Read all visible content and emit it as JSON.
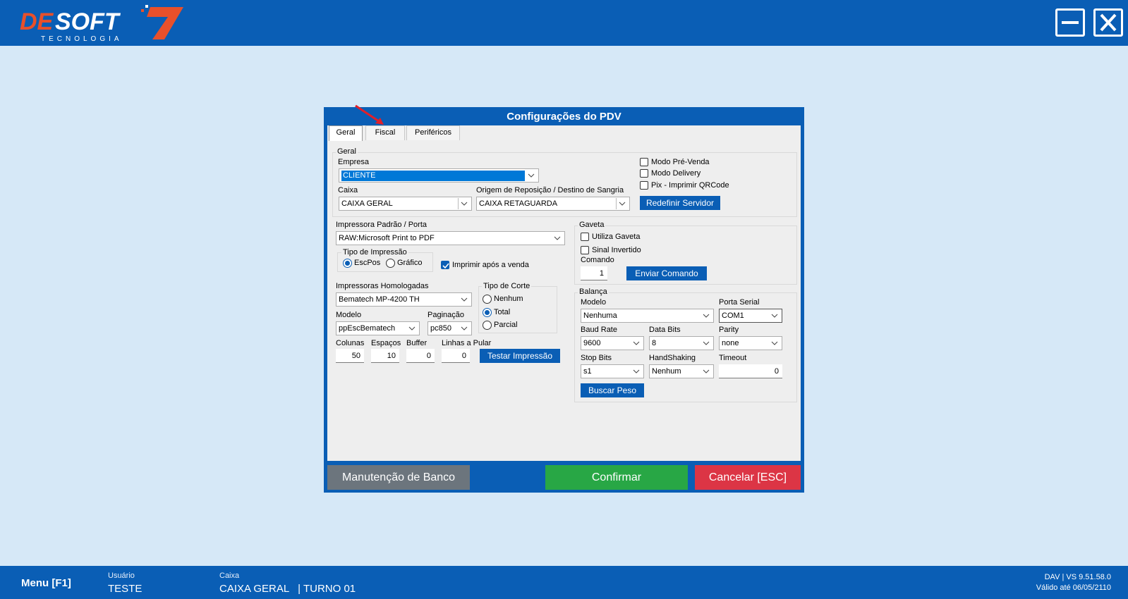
{
  "app": {
    "logo_text": "DESOFT7",
    "logo_subtitle": "TECNOLOGIA"
  },
  "colors": {
    "primary": "#0a5eb5",
    "background": "#d6e8f7",
    "confirm": "#28a745",
    "cancel": "#dc3545",
    "maintenance": "#6c757d"
  },
  "dialog": {
    "title": "Configurações do PDV",
    "tabs": [
      {
        "label": "Geral",
        "active": true
      },
      {
        "label": "Fiscal",
        "active": false
      },
      {
        "label": "Periféricos",
        "active": false
      }
    ],
    "geral": {
      "group_label": "Geral",
      "empresa_label": "Empresa",
      "empresa_value": "CLIENTE",
      "caixa_label": "Caixa",
      "caixa_value": "CAIXA GERAL",
      "origem_label": "Origem de Reposição / Destino de Sangria",
      "origem_value": "CAIXA RETAGUARDA",
      "modo_pre_venda": "Modo Pré-Venda",
      "modo_delivery": "Modo Delivery",
      "pix_qrcode": "Pix - Imprimir QRCode",
      "redefinir_servidor": "Redefinir Servidor"
    },
    "impressora": {
      "padrao_label": "Impressora Padrão / Porta",
      "padrao_value": "RAW:Microsoft Print to PDF",
      "tipo_label": "Tipo de Impressão",
      "escpos": "EscPos",
      "grafico": "Gráfico",
      "imprimir_apos": "Imprimir após a venda",
      "homologadas_label": "Impressoras Homologadas",
      "homologadas_value": "Bematech MP-4200 TH",
      "modelo_label": "Modelo",
      "modelo_value": "ppEscBematech",
      "paginacao_label": "Paginação",
      "paginacao_value": "pc850",
      "corte_label": "Tipo de Corte",
      "corte_nenhum": "Nenhum",
      "corte_total": "Total",
      "corte_parcial": "Parcial",
      "colunas_label": "Colunas",
      "colunas_value": "50",
      "espacos_label": "Espaços",
      "espacos_value": "10",
      "buffer_label": "Buffer",
      "buffer_value": "0",
      "linhas_label": "Linhas a Pular",
      "linhas_value": "0",
      "testar": "Testar Impressão"
    },
    "gaveta": {
      "group_label": "Gaveta",
      "utiliza": "Utiliza Gaveta",
      "sinal_invertido": "Sinal Invertido",
      "comando_label": "Comando",
      "comando_value": "1",
      "enviar": "Enviar Comando"
    },
    "balanca": {
      "group_label": "Balança",
      "modelo_label": "Modelo",
      "modelo_value": "Nenhuma",
      "porta_label": "Porta Serial",
      "porta_value": "COM1",
      "baud_label": "Baud Rate",
      "baud_value": "9600",
      "databits_label": "Data Bits",
      "databits_value": "8",
      "parity_label": "Parity",
      "parity_value": "none",
      "stopbits_label": "Stop Bits",
      "stopbits_value": "s1",
      "handshaking_label": "HandShaking",
      "handshaking_value": "Nenhum",
      "timeout_label": "Timeout",
      "timeout_value": "0",
      "buscar": "Buscar Peso"
    },
    "footer": {
      "manutencao": "Manutenção de Banco",
      "confirmar": "Confirmar",
      "cancelar": "Cancelar [ESC]"
    }
  },
  "statusbar": {
    "menu": "Menu [F1]",
    "usuario_label": "Usuário",
    "usuario_value": "TESTE",
    "caixa_label": "Caixa",
    "caixa_value": "CAIXA GERAL   | TURNO 01",
    "version": "DAV | VS 9.51.58.0",
    "validade": "Válido até 06/05/2110"
  }
}
